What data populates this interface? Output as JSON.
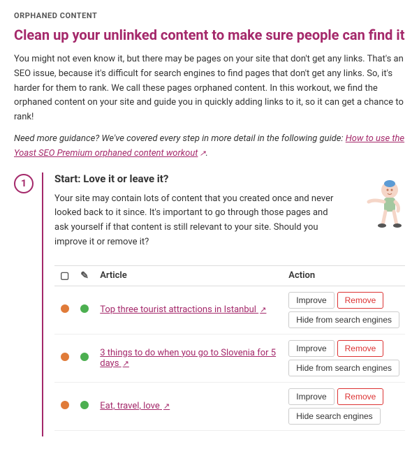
{
  "section": {
    "label": "ORPHANED CONTENT",
    "title": "Clean up your unlinked content to make sure people can find it",
    "intro": "You might not even know it, but there may be pages on your site that don't get any links. That's an SEO issue, because it's difficult for search engines to find pages that don't get any links. So, it's harder for them to rank. We call these pages orphaned content. In this workout, we find the orphaned content on your site and guide you in quickly adding links to it, so it can get a chance to rank!",
    "guide_prefix": "Need more guidance? We've covered every step in more detail in the following guide: ",
    "guide_link_text": "How to use the Yoast SEO Premium orphaned content workout",
    "step1": {
      "number": "1",
      "title": "Start: Love it or leave it?",
      "description": "Your site may contain lots of content that you created once and never looked back to it since. It's important to go through those pages and ask yourself if that content is still relevant to your site. Should you improve it or remove it?",
      "table": {
        "columns": [
          "",
          "",
          "Article",
          "Action"
        ],
        "rows": [
          {
            "dot1": "orange",
            "dot2": "green",
            "article_text": "Top three tourist attractions in Istanbul",
            "article_has_link": true,
            "btn_improve": "Improve",
            "btn_remove": "Remove",
            "btn_hide": "Hide from search engines"
          },
          {
            "dot1": "orange",
            "dot2": "green",
            "article_text": "3 things to do when you go to Slovenia for 5 days",
            "article_has_link": true,
            "btn_improve": "Improve",
            "btn_remove": "Remove",
            "btn_hide": "Hide from search engines"
          },
          {
            "dot1": "orange",
            "dot2": "green",
            "article_text": "Eat, travel, love",
            "article_has_link": true,
            "btn_improve": "Improve",
            "btn_remove": "Remove",
            "btn_hide": "Hide search engines"
          }
        ]
      }
    }
  }
}
